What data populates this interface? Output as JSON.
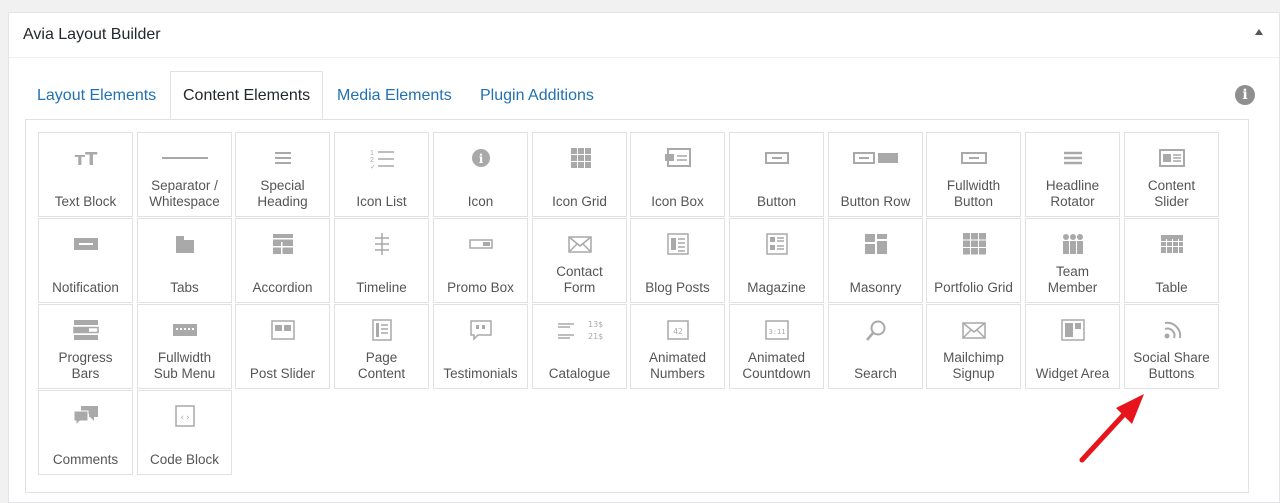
{
  "panel": {
    "title": "Avia Layout Builder"
  },
  "tabs": [
    {
      "label": "Layout Elements"
    },
    {
      "label": "Content Elements",
      "active": true
    },
    {
      "label": "Media Elements"
    },
    {
      "label": "Plugin Additions"
    }
  ],
  "elements": [
    {
      "label": "Text Block",
      "icon": "text-block-icon"
    },
    {
      "label": "Separator /\nWhitespace",
      "icon": "separator-icon"
    },
    {
      "label": "Special\nHeading",
      "icon": "heading-icon"
    },
    {
      "label": "Icon List",
      "icon": "icon-list-icon"
    },
    {
      "label": "Icon",
      "icon": "info-circle-icon"
    },
    {
      "label": "Icon Grid",
      "icon": "icon-grid-icon"
    },
    {
      "label": "Icon Box",
      "icon": "icon-box-icon"
    },
    {
      "label": "Button",
      "icon": "button-icon"
    },
    {
      "label": "Button Row",
      "icon": "button-row-icon"
    },
    {
      "label": "Fullwidth\nButton",
      "icon": "fullwidth-button-icon"
    },
    {
      "label": "Headline\nRotator",
      "icon": "headline-rotator-icon"
    },
    {
      "label": "Content\nSlider",
      "icon": "content-slider-icon"
    },
    {
      "label": "Notification",
      "icon": "notification-icon"
    },
    {
      "label": "Tabs",
      "icon": "tabs-icon"
    },
    {
      "label": "Accordion",
      "icon": "accordion-icon"
    },
    {
      "label": "Timeline",
      "icon": "timeline-icon"
    },
    {
      "label": "Promo Box",
      "icon": "promo-box-icon"
    },
    {
      "label": "Contact\nForm",
      "icon": "envelope-icon"
    },
    {
      "label": "Blog Posts",
      "icon": "blog-posts-icon"
    },
    {
      "label": "Magazine",
      "icon": "magazine-icon"
    },
    {
      "label": "Masonry",
      "icon": "masonry-icon"
    },
    {
      "label": "Portfolio Grid",
      "icon": "portfolio-grid-icon"
    },
    {
      "label": "Team\nMember",
      "icon": "team-member-icon"
    },
    {
      "label": "Table",
      "icon": "table-icon"
    },
    {
      "label": "Progress\nBars",
      "icon": "progress-bars-icon"
    },
    {
      "label": "Fullwidth\nSub Menu",
      "icon": "sub-menu-icon"
    },
    {
      "label": "Post Slider",
      "icon": "post-slider-icon"
    },
    {
      "label": "Page\nContent",
      "icon": "page-content-icon"
    },
    {
      "label": "Testimonials",
      "icon": "testimonials-icon"
    },
    {
      "label": "Catalogue",
      "icon": "catalogue-icon",
      "glyph_lines": [
        "13$",
        "21$"
      ]
    },
    {
      "label": "Animated\nNumbers",
      "icon": "animated-numbers-icon",
      "glyph": "42"
    },
    {
      "label": "Animated\nCountdown",
      "icon": "countdown-icon",
      "glyph": "3:11"
    },
    {
      "label": "Search",
      "icon": "search-icon"
    },
    {
      "label": "Mailchimp\nSignup",
      "icon": "mailchimp-icon"
    },
    {
      "label": "Widget Area",
      "icon": "widget-area-icon"
    },
    {
      "label": "Social Share\nButtons",
      "icon": "social-share-icon"
    },
    {
      "label": "Comments",
      "icon": "comments-icon"
    },
    {
      "label": "Code Block",
      "icon": "code-block-icon"
    }
  ],
  "colors": {
    "icon": "#a9a9a9",
    "tab_link": "#2271b1",
    "arrow": "#e8141b"
  }
}
